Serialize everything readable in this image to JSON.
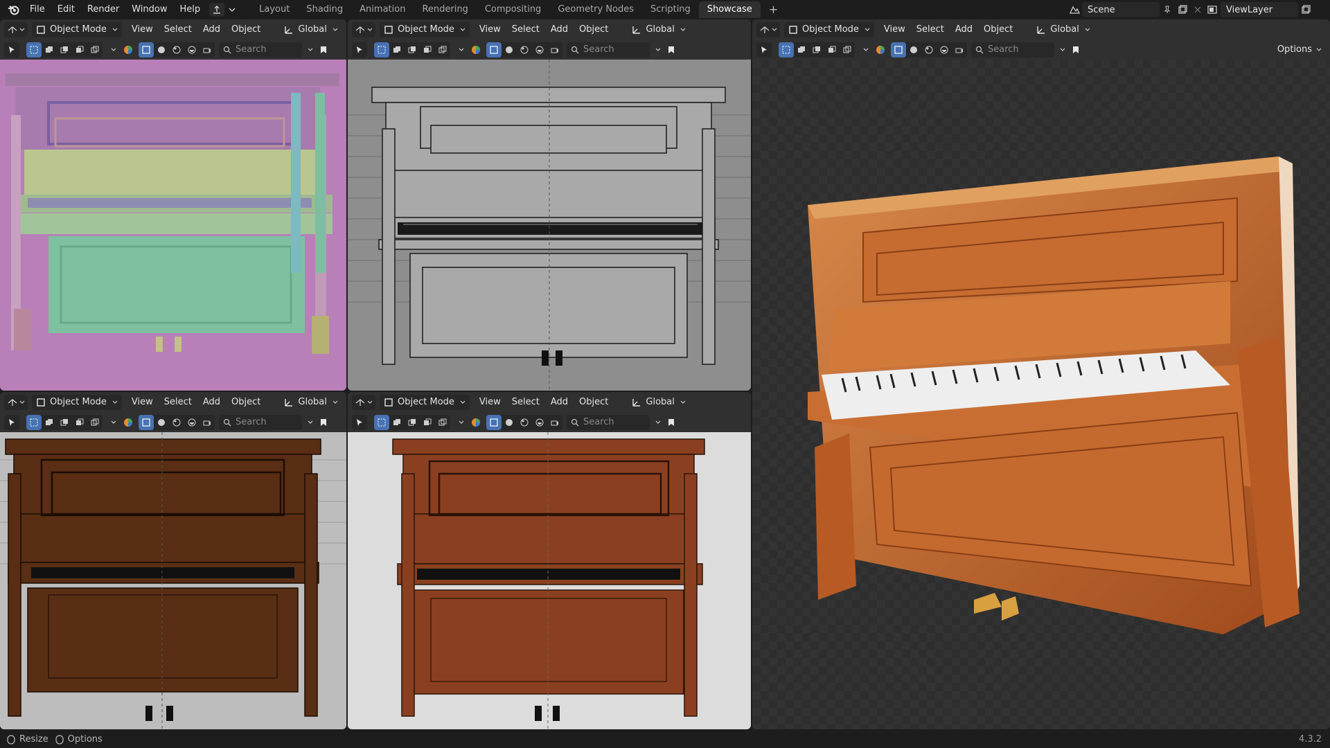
{
  "topbar": {
    "menus": [
      "File",
      "Edit",
      "Render",
      "Window",
      "Help"
    ],
    "workspaces": [
      "Layout",
      "Shading",
      "Animation",
      "Rendering",
      "Compositing",
      "Geometry Nodes",
      "Scripting",
      "Showcase"
    ],
    "active_workspace": "Showcase",
    "add_tab": "+",
    "scene": "Scene",
    "view_layer": "ViewLayer"
  },
  "viewport_header": {
    "mode": "Object Mode",
    "menus": [
      "View",
      "Select",
      "Add",
      "Object"
    ],
    "orientation": "Global",
    "search_placeholder": "Search",
    "options": "Options"
  },
  "viewports": [
    {
      "shading": "solid-random-color",
      "view": "front-orthographic"
    },
    {
      "shading": "wireframe",
      "view": "front-orthographic"
    },
    {
      "shading": "textured-wireframe-overlay",
      "view": "front-orthographic"
    },
    {
      "shading": "textured-wireframe-overlay-light",
      "view": "front-orthographic"
    },
    {
      "shading": "rendered",
      "view": "perspective"
    }
  ],
  "statusbar": {
    "resize": "Resize",
    "options": "Options",
    "version": "4.3.2"
  },
  "colors": {
    "accent": "#4772b3",
    "active_tab": "#303030",
    "wood_dark": "#5a2e14",
    "wood_light": "#c0622a"
  }
}
